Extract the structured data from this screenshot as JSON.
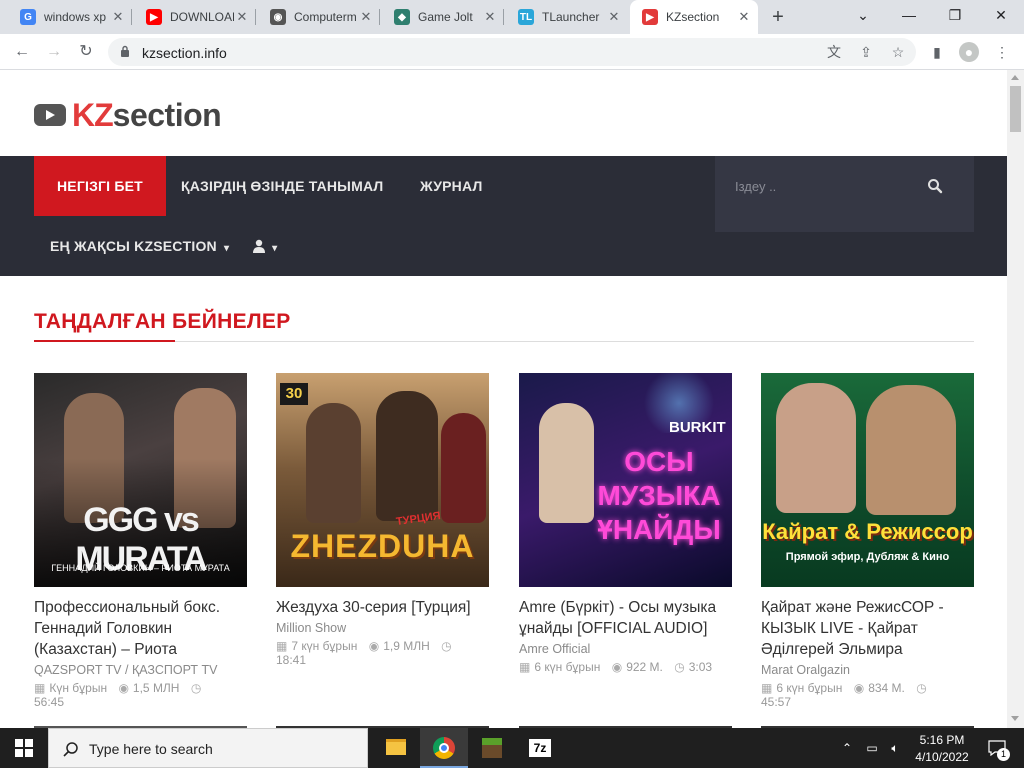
{
  "browser": {
    "tabs": [
      {
        "title": "windows xp",
        "fav": "G",
        "color": "#4285f4",
        "active": false
      },
      {
        "title": "DOWNLOAD",
        "fav": "▶",
        "color": "#ff0000",
        "active": false
      },
      {
        "title": "Computerm",
        "fav": "◉",
        "color": "#555555",
        "active": false
      },
      {
        "title": "Game Jolt",
        "fav": "◆",
        "color": "#2f7f6f",
        "active": false
      },
      {
        "title": "TLauncher",
        "fav": "TL",
        "color": "#2aa6d9",
        "active": false
      },
      {
        "title": "KZsection",
        "fav": "▶",
        "color": "#e23b3b",
        "active": true
      }
    ],
    "url": "kzsection.info"
  },
  "site": {
    "logo_kz": "KZ",
    "logo_rest": "section",
    "nav": {
      "home": "НЕГІЗГІ БЕТ",
      "popular": "ҚАЗІРДІҢ ӨЗІНДЕ ТАНЫМАЛ",
      "journal": "ЖУРНАЛ",
      "best": "ЕҢ ЖАҚСЫ KZSECTION",
      "search_placeholder": "Іздеу .."
    },
    "section_title": "ТАҢДАЛҒАН БЕЙНЕЛЕР",
    "videos": [
      {
        "title": "Профессиональный бокс. Геннадий Головкин (Казахстан) – Риота",
        "channel": "QAZSPORT TV / ҚАЗСПОРТ TV",
        "date": "Күн бұрын",
        "views": "1,5 МЛН",
        "duration": "56:45",
        "thumb_big": "GGG vs MURATA",
        "thumb_small": "ГЕННАДИЙ ГОЛОВКИН – РИОТА МУРАТА"
      },
      {
        "title": "Жездуха 30-серия [Турция]",
        "channel": "Million Show",
        "date": "7 күн бұрын",
        "views": "1,9 МЛН",
        "duration": "18:41",
        "thumb_big": "ZHEZDUHA",
        "thumb_small": "30",
        "thumb_tag": "ТУРЦИЯ"
      },
      {
        "title": "Amre (Бүркіт) - Осы музыка ұнайды [OFFICIAL AUDIO]",
        "channel": "Amre Official",
        "date": "6 күн бұрын",
        "views": "922 М.",
        "duration": "3:03",
        "thumb_big": "ОСЫ МУЗЫКА ҰНАЙДЫ",
        "thumb_small": "BURKIT"
      },
      {
        "title": "Қайрат және РежисСОР - КЫЗЫК LIVE - Қайрат Әділгерей Эльмира",
        "channel": "Marat Oralgazin",
        "date": "6 күн бұрын",
        "views": "834 М.",
        "duration": "45:57",
        "thumb_big": "Кайрат & Режиссор",
        "thumb_small": "Прямой эфир, Дубляж & Кино"
      }
    ]
  },
  "taskbar": {
    "search_text": "Type here to search",
    "time": "5:16 PM",
    "date": "4/10/2022",
    "notif_count": "1"
  }
}
